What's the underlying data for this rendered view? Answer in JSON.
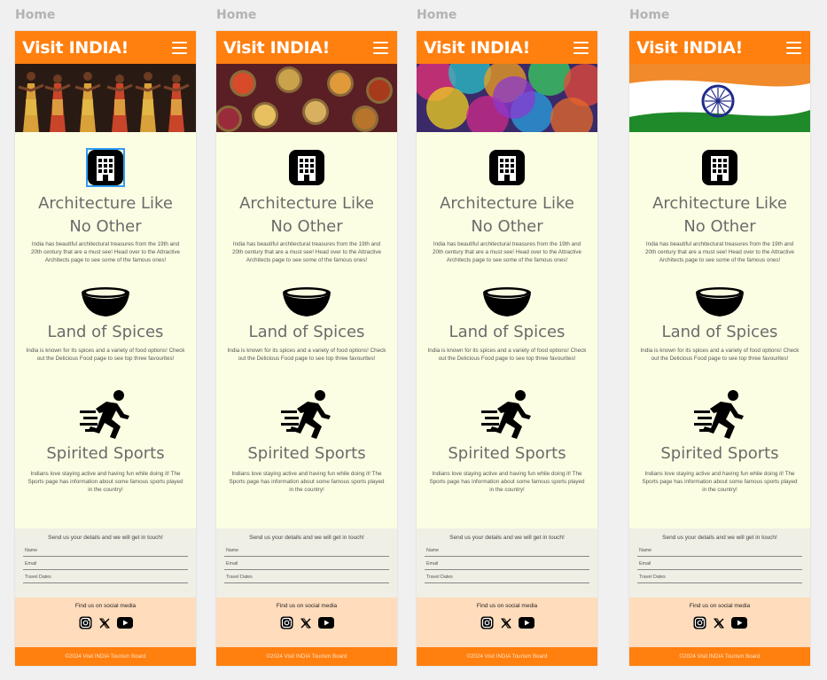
{
  "frames": [
    {
      "label": "Home",
      "hero": "dancers-photo",
      "architecture_icon_selected": true
    },
    {
      "label": "Home",
      "hero": "spices-photo",
      "architecture_icon_selected": false
    },
    {
      "label": "Home",
      "hero": "holi-colors-photo",
      "architecture_icon_selected": false
    },
    {
      "label": "Home",
      "hero": "indian-flag-photo",
      "architecture_icon_selected": false
    }
  ],
  "brand": "Visit INDIA!",
  "sections": [
    {
      "icon": "building-icon",
      "title_line1": "Architecture Like",
      "title_line2": "No Other",
      "text": "India has beautiful architectural treasures from the 19th and 20th century that are a must see! Head over to the Attractive Architects page to see some of the famous ones!"
    },
    {
      "icon": "bowl-icon",
      "title_line1": "Land of Spices",
      "text": "India is known for its spices and a variety of food options! Check out the Delicious Food page to see top three favourites!"
    },
    {
      "icon": "running-person-icon",
      "title_line1": "Spirited Sports",
      "text": "Indians love staying active and having fun while doing it! The Sports page has information about some famous sports played in the country!"
    }
  ],
  "contact": {
    "title": "Send us your details and we will get in touch!",
    "fields": [
      "Name",
      "Email",
      "Travel Dates"
    ]
  },
  "social": {
    "title": "Find us on social media",
    "icons": [
      "instagram-icon",
      "x-icon",
      "youtube-icon"
    ]
  },
  "footer": "©2024 Visit INDIA Tourism Board",
  "colors": {
    "accent": "#ff7f0f",
    "page_bg": "#fcfee3",
    "contact_bg": "#efefe5",
    "social_bg": "#ffdcbc",
    "selection": "#2f9bf5"
  }
}
